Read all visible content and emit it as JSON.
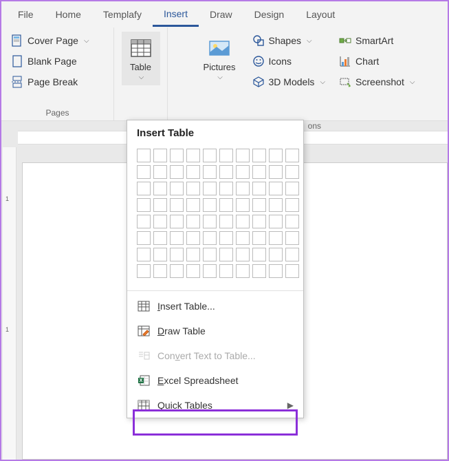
{
  "tabs": [
    "File",
    "Home",
    "Templafy",
    "Insert",
    "Draw",
    "Design",
    "Layout"
  ],
  "active_tab": "Insert",
  "pages_group": {
    "label": "Pages",
    "cover_page": "Cover Page",
    "blank_page": "Blank Page",
    "page_break": "Page Break"
  },
  "table_group": {
    "label": "Table"
  },
  "pictures_label": "Pictures",
  "shapes_label": "Shapes",
  "icons_label": "Icons",
  "models_label": "3D Models",
  "smartart_label": "SmartArt",
  "chart_label": "Chart",
  "screenshot_label": "Screenshot",
  "dropdown": {
    "title": "Insert Table",
    "insert_table": "Insert Table...",
    "draw_table": "Draw Table",
    "convert_text": "Convert Text to Table...",
    "excel": "Excel Spreadsheet",
    "quick_tables": "Quick Tables"
  },
  "truncated_label": "ons"
}
